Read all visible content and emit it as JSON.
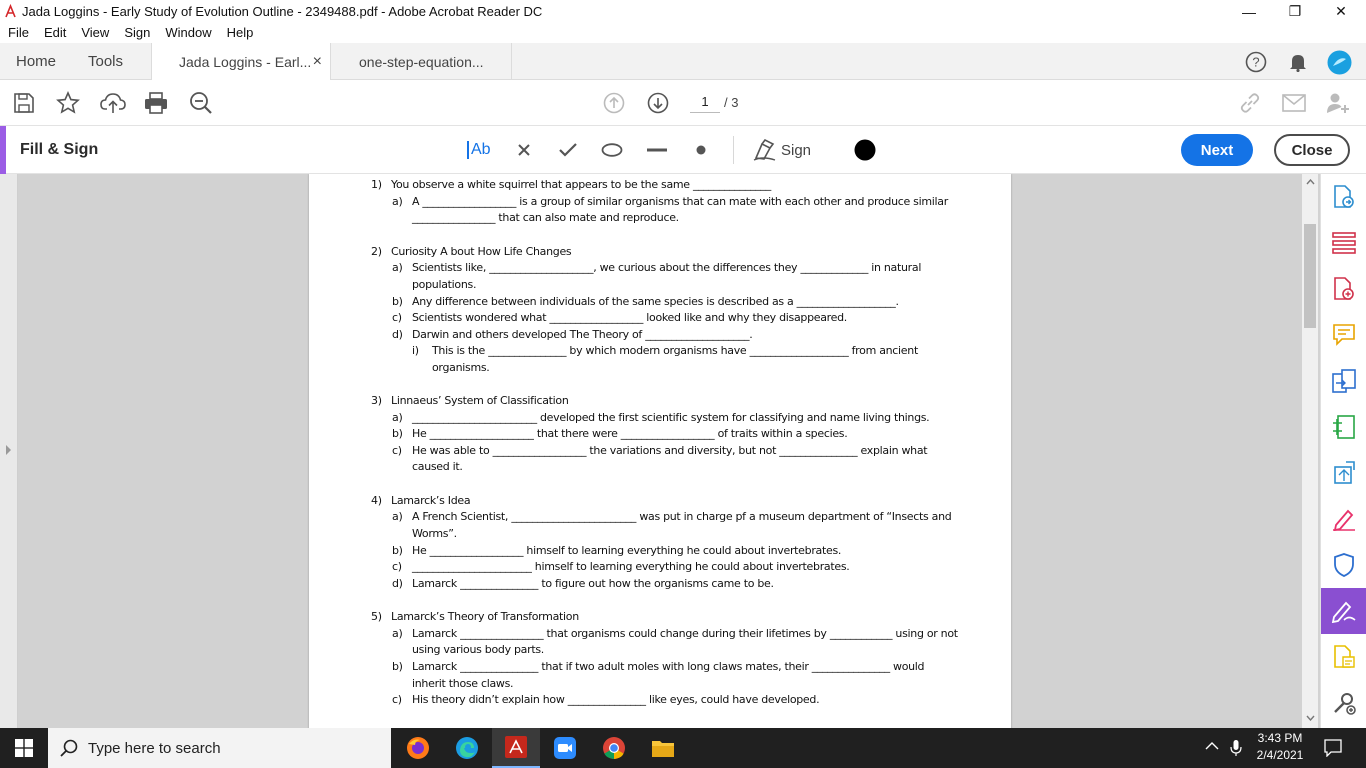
{
  "window": {
    "title": "Jada Loggins - Early Study of Evolution Outline - 2349488.pdf - Adobe Acrobat Reader DC",
    "minimize": "—",
    "restore": "❐",
    "close": "✕"
  },
  "menu": [
    "File",
    "Edit",
    "View",
    "Sign",
    "Window",
    "Help"
  ],
  "tabs": {
    "home": "Home",
    "tools": "Tools",
    "doc1": "Jada Loggins - Earl...",
    "doc1_close": "×",
    "doc2": "one-step-equation..."
  },
  "toolbar": {
    "page_current": "1",
    "page_total": "/ 3"
  },
  "fill_sign": {
    "title": "Fill & Sign",
    "text_tool": "Ab",
    "sign_label": "Sign",
    "next": "Next",
    "close": "Close",
    "accent_color": "#9b5de5",
    "primary_color": "#1473e6"
  },
  "document": {
    "lines": [
      {
        "num": "1)",
        "text": "You observe a white squirrel that appears to be the same _______________"
      },
      {
        "num": "a)",
        "text": "A __________________ is a group of similar organisms that can mate with each other and produce similar"
      },
      {
        "num": "",
        "text": "________________ that can also mate and reproduce."
      },
      {
        "num": "2)",
        "text": "Curiosity A bout How Life Changes"
      },
      {
        "num": "a)",
        "text": "Scientists like, ____________________, we curious about the differences they _____________ in natural"
      },
      {
        "num": "",
        "text": "populations."
      },
      {
        "num": "b)",
        "text": "Any difference between individuals of the same species is described as a ___________________."
      },
      {
        "num": "c)",
        "text": "Scientists wondered what __________________ looked like and why they disappeared."
      },
      {
        "num": "d)",
        "text": "Darwin and others developed The Theory of ____________________."
      },
      {
        "num": "i)",
        "text": "This is the _______________ by which modern organisms have ___________________ from ancient"
      },
      {
        "num": "",
        "text": "organisms."
      },
      {
        "num": "3)",
        "text": "Linnaeus’ System of Classification"
      },
      {
        "num": "a)",
        "text": "________________________ developed the first scientific system for classifying and name living things."
      },
      {
        "num": "b)",
        "text": "He ____________________ that there were __________________ of traits within a species."
      },
      {
        "num": "c)",
        "text": "He was able to __________________ the variations and diversity, but not _______________ explain what"
      },
      {
        "num": "",
        "text": "caused it."
      },
      {
        "num": "4)",
        "text": "Lamarck’s Idea"
      },
      {
        "num": "a)",
        "text": "A French Scientist, ________________________ was put in charge pf a museum department of “Insects and"
      },
      {
        "num": "",
        "text": "Worms”."
      },
      {
        "num": "b)",
        "text": "He __________________ himself to learning everything he could about invertebrates."
      },
      {
        "num": "c)",
        "text": "_______________________ himself to learning everything he could about invertebrates."
      },
      {
        "num": "d)",
        "text": "Lamarck _______________ to figure out how the organisms came to be."
      },
      {
        "num": "5)",
        "text": "Lamarck’s Theory of Transformation"
      },
      {
        "num": "a)",
        "text": "Lamarck ________________ that organisms could change during their lifetimes by ____________ using or not"
      },
      {
        "num": "",
        "text": "using various body parts."
      },
      {
        "num": "b)",
        "text": "Lamarck _______________ that if two adult moles with long claws mates, their _______________ would"
      },
      {
        "num": "",
        "text": "inherit those claws."
      },
      {
        "num": "c)",
        "text": "His theory didn’t explain how _______________ like eyes, could have developed."
      }
    ]
  },
  "taskbar": {
    "search_placeholder": "Type here to search",
    "time": "3:43 PM",
    "date": "2/4/2021"
  }
}
